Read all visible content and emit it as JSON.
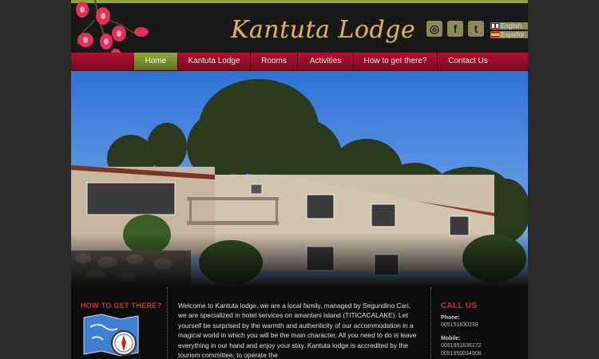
{
  "header": {
    "logo_text": "Kantuta Lodge",
    "social": [
      {
        "icon": "tripadvisor-icon",
        "glyph": "◎"
      },
      {
        "icon": "facebook-icon",
        "glyph": "f"
      },
      {
        "icon": "twitter-icon",
        "glyph": "t"
      }
    ],
    "languages": [
      "English",
      "Español"
    ]
  },
  "nav": {
    "items": [
      "Home",
      "Kantuta Lodge",
      "Rooms",
      "Activities",
      "How to get there?",
      "Contact Us"
    ],
    "active_index": 0
  },
  "colors": {
    "nav_red": "#b1102f",
    "active_green": "#8fa840",
    "heading_red": "#c0392b",
    "logo_gold": "#d6b25a"
  },
  "bottom": {
    "left_heading": "HOW TO GET THERE?",
    "welcome_text": "Welcome to Kantuta lodge, we are a local family, managed by Segundino Cari, we are specialized in hotel services on amantani island (TITICACALAKE). Let yourself be surprised by the warmth and authenticity of our accommodation in a magical world in which you will be the main character. All you need to do is leave everything in our hand and enjoy your stay. Kantuta lodge is accredited by the tourism committee, to operate the",
    "contact_heading": "CALL US",
    "phone_label": "Phone:",
    "phone_value": "005151630238",
    "mobile_label": "Mobile:",
    "mobile_values": [
      "0051951636172",
      "0051950034908"
    ]
  }
}
